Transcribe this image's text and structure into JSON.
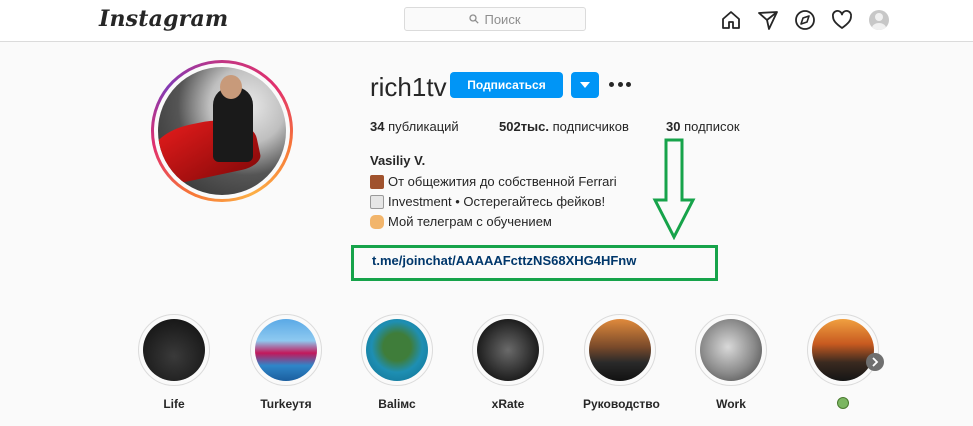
{
  "header": {
    "logo": "Instagram",
    "search_placeholder": "Поиск",
    "icons": [
      "home-icon",
      "direct-icon",
      "explore-icon",
      "heart-icon",
      "avatar-icon"
    ]
  },
  "profile": {
    "username": "rich1tv",
    "follow_label": "Подписаться",
    "stats": {
      "posts_count": "34",
      "posts_label": "публикаций",
      "followers_count": "502тыс.",
      "followers_label": "подписчиков",
      "following_count": "30",
      "following_label": "подписок"
    },
    "full_name": "Vasiliy V.",
    "bio": [
      "От общежития до собственной Ferrari",
      "Investment • Остерегайтесь фейков!",
      "Мой телеграм с обучением"
    ],
    "link": "t.me/joinchat/AAAAAFcttzNS68XHG4HFnw"
  },
  "stories": [
    {
      "label": "Life"
    },
    {
      "label": "Turkeyтя"
    },
    {
      "label": "Baliмс"
    },
    {
      "label": "xRate"
    },
    {
      "label": "Руководство"
    },
    {
      "label": "Work"
    },
    {
      "label": ""
    }
  ],
  "colors": {
    "accent": "#0095f6",
    "annotation_green": "#16a34a",
    "link": "#00376b"
  }
}
